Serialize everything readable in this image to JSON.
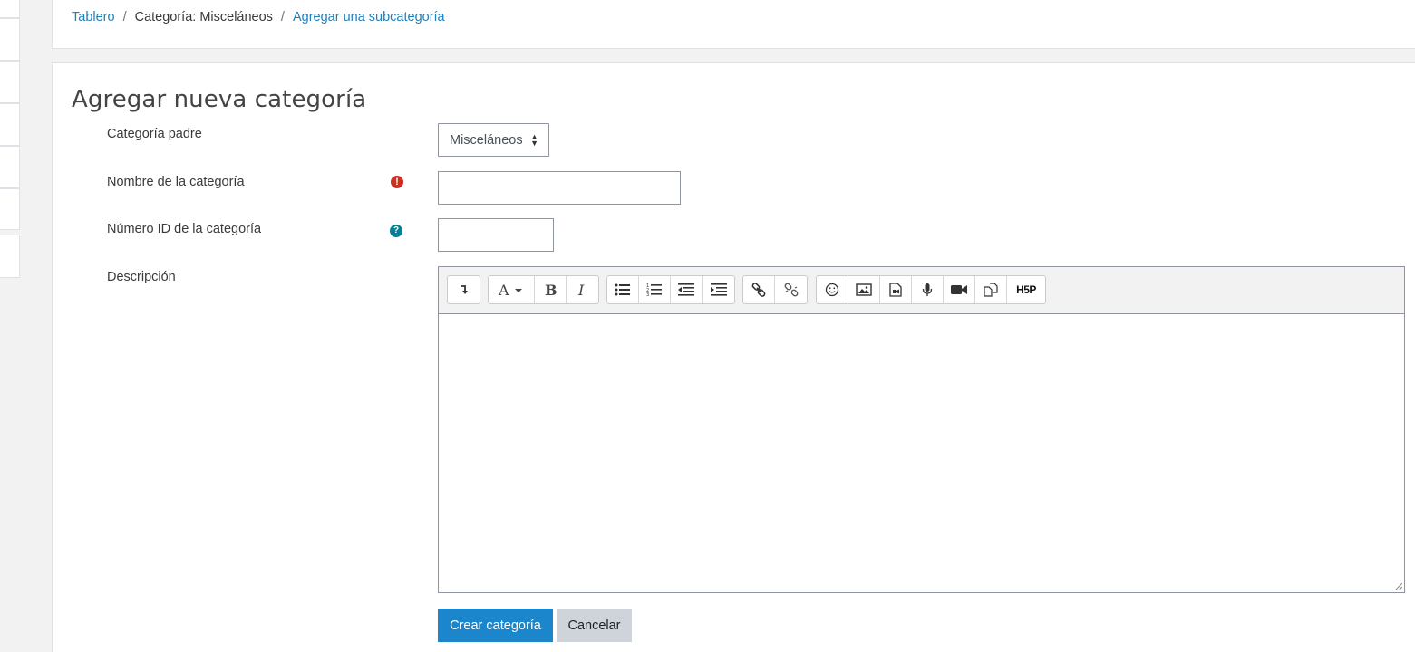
{
  "breadcrumb": {
    "home": "Tablero",
    "category": "Categoría: Misceláneos",
    "current": "Agregar una subcategoría"
  },
  "page": {
    "title": "Agregar nueva categoría"
  },
  "form": {
    "parent_label": "Categoría padre",
    "parent_value": "Misceláneos",
    "name_label": "Nombre de la categoría",
    "name_value": "",
    "idnumber_label": "Número ID de la categoría",
    "idnumber_value": "",
    "description_label": "Descripción",
    "required_icon": "exclamation-circle-icon",
    "help_icon": "question-circle-icon"
  },
  "editor": {
    "toolbar_icons": [
      "show-more-icon",
      "font-style-icon",
      "bold-icon",
      "italic-icon",
      "unordered-list-icon",
      "ordered-list-icon",
      "outdent-icon",
      "indent-icon",
      "link-icon",
      "unlink-icon",
      "emoji-icon",
      "image-icon",
      "media-icon",
      "record-audio-icon",
      "record-video-icon",
      "manage-files-icon",
      "h5p-icon"
    ],
    "h5p_label": "H5P"
  },
  "buttons": {
    "submit": "Crear categoría",
    "cancel": "Cancelar"
  },
  "colors": {
    "link": "#1f7fba",
    "primary": "#1b86cc",
    "required": "#ca3120",
    "help": "#008196"
  }
}
